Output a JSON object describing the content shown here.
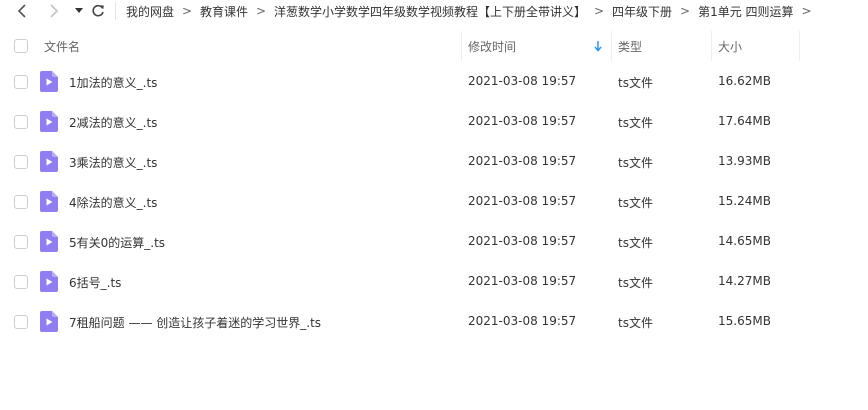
{
  "nav": {
    "back_icon": "chevron-left-icon",
    "forward_icon": "chevron-right-icon",
    "dropdown_icon": "caret-down-icon",
    "refresh_icon": "refresh-icon"
  },
  "breadcrumb": {
    "items": [
      "我的网盘",
      "教育课件",
      "洋葱数学小学数学四年级数学视频教程【上下册全带讲义】",
      "四年级下册",
      "第1单元 四则运算"
    ],
    "separator": ">"
  },
  "table": {
    "headers": {
      "name": "文件名",
      "modified": "修改时间",
      "type": "类型",
      "size": "大小"
    },
    "sort_icon": "sort-down-arrow-icon",
    "sort_color": "#1e90ff",
    "file_icon_color": "#8e7ef2",
    "rows": [
      {
        "name": "1加法的意义_.ts",
        "modified": "2021-03-08 19:57",
        "type": "ts文件",
        "size": "16.62MB"
      },
      {
        "name": "2减法的意义_.ts",
        "modified": "2021-03-08 19:57",
        "type": "ts文件",
        "size": "17.64MB"
      },
      {
        "name": "3乘法的意义_.ts",
        "modified": "2021-03-08 19:57",
        "type": "ts文件",
        "size": "13.93MB"
      },
      {
        "name": "4除法的意义_.ts",
        "modified": "2021-03-08 19:57",
        "type": "ts文件",
        "size": "15.24MB"
      },
      {
        "name": "5有关0的运算_.ts",
        "modified": "2021-03-08 19:57",
        "type": "ts文件",
        "size": "14.65MB"
      },
      {
        "name": "6括号_.ts",
        "modified": "2021-03-08 19:57",
        "type": "ts文件",
        "size": "14.27MB"
      },
      {
        "name": "7租船问题 —— 创造让孩子着迷的学习世界_.ts",
        "modified": "2021-03-08 19:57",
        "type": "ts文件",
        "size": "15.65MB"
      }
    ]
  }
}
